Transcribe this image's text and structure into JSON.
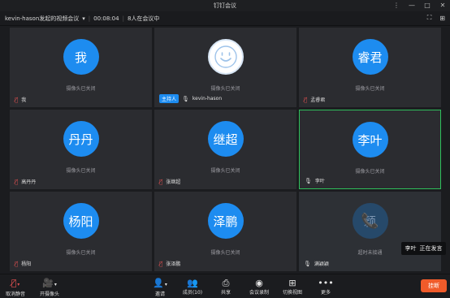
{
  "window": {
    "title": "钉钉会议",
    "controls": [
      "⋮",
      "—",
      "□",
      "✕"
    ]
  },
  "meeting": {
    "title": "kevin-hason发起的视频会议",
    "duration": "00:08:04",
    "participants_text": "8人在会议中"
  },
  "tiles": [
    {
      "avatar": "我",
      "camera_status": "摄像头已关闭",
      "name": "我",
      "mic": "muted"
    },
    {
      "avatar": "smile",
      "camera_status": "摄像头已关闭",
      "host_badge": "主持人",
      "name": "kevin-hason",
      "mic": "on"
    },
    {
      "avatar": "睿君",
      "camera_status": "摄像头已关闭",
      "name": "孟睿君",
      "mic": "muted"
    },
    {
      "avatar": "丹丹",
      "camera_status": "摄像头已关闭",
      "name": "高丹丹",
      "mic": "muted"
    },
    {
      "avatar": "继超",
      "camera_status": "摄像头已关闭",
      "name": "张继超",
      "mic": "muted"
    },
    {
      "avatar": "李叶",
      "camera_status": "摄像头已关闭",
      "name": "李叶",
      "mic": "on",
      "speaking": true
    },
    {
      "avatar": "杨阳",
      "camera_status": "摄像头已关闭",
      "name": "杨阳",
      "mic": "muted"
    },
    {
      "avatar": "泽鹏",
      "camera_status": "摄像头已关闭",
      "name": "张泽鹏",
      "mic": "muted"
    },
    {
      "avatar": "颖",
      "camera_status": "超时未接通",
      "name": "满颖颖",
      "mic": "on"
    }
  ],
  "tooltip": {
    "name": "李叶",
    "status": "正在发言"
  },
  "toolbar": {
    "unmute": "取消静音",
    "camera": "开摄像头",
    "invite": "邀请",
    "members": "成员(10)",
    "share": "共享",
    "record": "会议录制",
    "switch_view": "切换视图",
    "more": "更多",
    "end": "挂断"
  },
  "colors": {
    "accent": "#1d8cf0",
    "speaking_border": "#2fbf5b",
    "end_button": "#f05b2a",
    "muted": "#e05050"
  }
}
